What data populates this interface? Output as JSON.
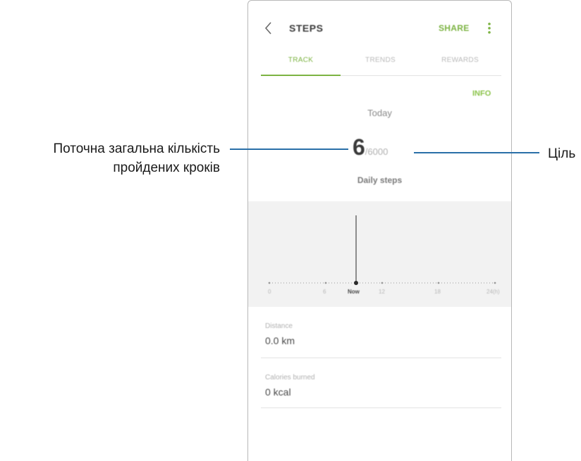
{
  "app": {
    "title": "STEPS",
    "share_label": "SHARE",
    "tabs": [
      {
        "label": "TRACK",
        "active": true
      },
      {
        "label": "TRENDS",
        "active": false
      },
      {
        "label": "REWARDS",
        "active": false
      }
    ],
    "info_label": "INFO",
    "day_label": "Today",
    "steps_count": "6",
    "steps_goal": "/6000",
    "daily_label": "Daily steps",
    "graph": {
      "axis_labels": [
        "0",
        "6",
        "Now",
        "12",
        "18",
        "24(h)"
      ]
    },
    "stats": [
      {
        "label": "Distance",
        "value": "0.0 km"
      },
      {
        "label": "Calories burned",
        "value": "0 kcal"
      }
    ],
    "accent_color": "#7cb342"
  },
  "callouts": {
    "left_line1": "Поточна загальна кількість",
    "left_line2": "пройдених кроків",
    "right": "Ціль",
    "line_color": "#2a6fa8"
  },
  "icons": {
    "back": "chevron-left-icon",
    "more": "more-vertical-icon"
  }
}
